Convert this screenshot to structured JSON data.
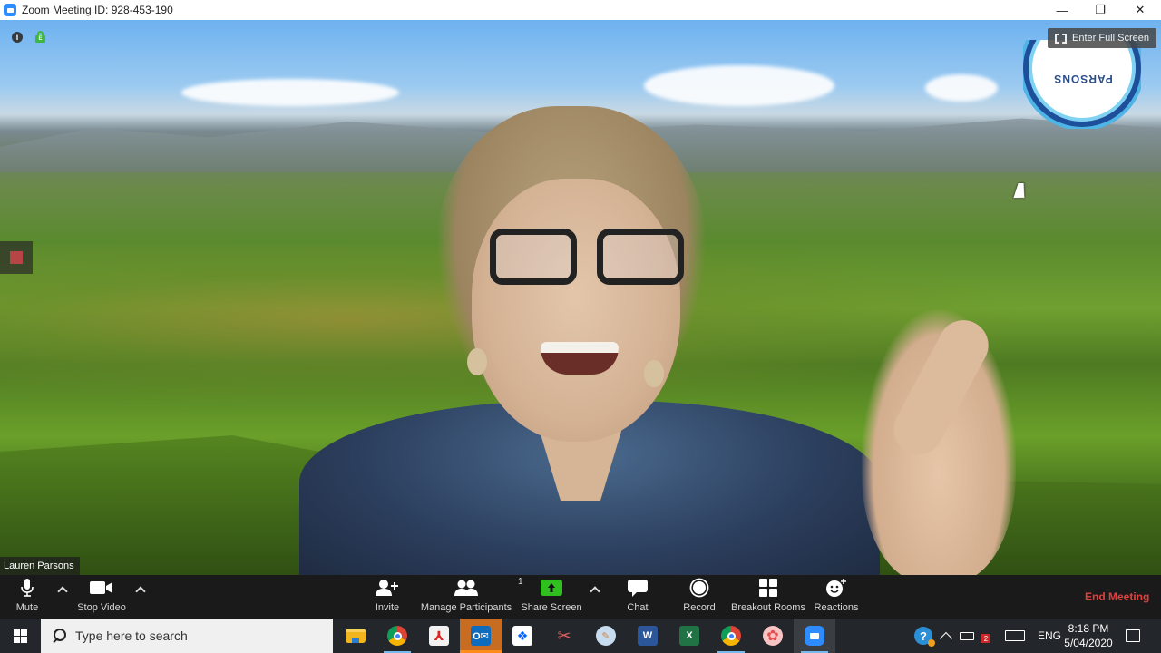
{
  "window": {
    "title": "Zoom Meeting ID: 928-453-190",
    "controls": {
      "minimize": "—",
      "restore": "❐",
      "close": "✕"
    }
  },
  "video": {
    "participant_name": "Lauren Parsons",
    "logo_text": "PARSONS",
    "fullscreen_label": "Enter Full Screen",
    "info_icon": "i",
    "encryption_badge": "E"
  },
  "toolbar": {
    "mute_label": "Mute",
    "stop_video_label": "Stop Video",
    "invite_label": "Invite",
    "participants_label": "Manage Participants",
    "participants_count": "1",
    "share_label": "Share Screen",
    "chat_label": "Chat",
    "record_label": "Record",
    "breakout_label": "Breakout Rooms",
    "reactions_label": "Reactions",
    "end_label": "End Meeting",
    "colors": {
      "share": "#2fbf1f",
      "end": "#e0403c"
    }
  },
  "taskbar": {
    "search_placeholder": "Type here to search",
    "apps": [
      {
        "name": "File Explorer",
        "glyph": "▬",
        "color": "#f2b51d"
      },
      {
        "name": "Google Chrome",
        "glyph": "●",
        "color": "#db4437"
      },
      {
        "name": "Adobe Acrobat",
        "glyph": "A",
        "color": "#e8e8e8"
      },
      {
        "name": "Outlook",
        "glyph": "O",
        "color": "#0f6cbd"
      },
      {
        "name": "Dropbox",
        "glyph": "✦",
        "color": "#ffffff"
      },
      {
        "name": "Snipping Tool",
        "glyph": "✂",
        "color": "#d24848"
      },
      {
        "name": "Paint",
        "glyph": "🎨",
        "color": "#8fb7e0"
      },
      {
        "name": "Word",
        "glyph": "W",
        "color": "#2b579a"
      },
      {
        "name": "Excel",
        "glyph": "X",
        "color": "#217346"
      },
      {
        "name": "Chrome Profile",
        "glyph": "●",
        "color": "#db4437"
      },
      {
        "name": "Petal App",
        "glyph": "✿",
        "color": "#f07a7a"
      },
      {
        "name": "Zoom",
        "glyph": "▶",
        "color": "#2d8cff"
      }
    ],
    "tray": {
      "help": "?",
      "chevron": "^",
      "badge_count": "2",
      "language": "ENG",
      "time": "8:18 PM",
      "date": "5/04/2020"
    }
  }
}
